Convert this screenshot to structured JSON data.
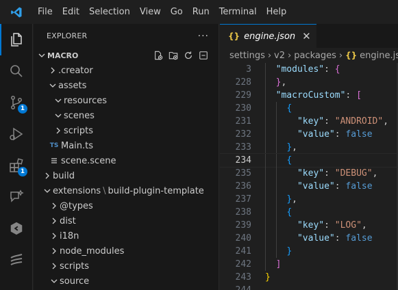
{
  "menu": [
    "File",
    "Edit",
    "Selection",
    "View",
    "Go",
    "Run",
    "Terminal",
    "Help"
  ],
  "activity": {
    "source_control_badge": "1",
    "extensions_badge": "1"
  },
  "explorer": {
    "title": "EXPLORER",
    "more": "···",
    "root": "MACRO",
    "tree": [
      {
        "label": ".creator",
        "chevron": "right"
      },
      {
        "label": "assets",
        "chevron": "down"
      },
      {
        "label": "resources",
        "chevron": "down"
      },
      {
        "label": "scenes",
        "chevron": "down"
      },
      {
        "label": "scripts",
        "chevron": "right"
      },
      {
        "label": "Main.ts",
        "type": "TS"
      },
      {
        "label": "scene.scene",
        "type": "scene"
      },
      {
        "label": "build",
        "chevron": "right"
      },
      {
        "label": "extensions",
        "label2": "build-plugin-template",
        "chevron": "down"
      },
      {
        "label": "@types",
        "chevron": "right"
      },
      {
        "label": "dist",
        "chevron": "right"
      },
      {
        "label": "i18n",
        "chevron": "right"
      },
      {
        "label": "node_modules",
        "chevron": "right"
      },
      {
        "label": "scripts",
        "chevron": "right"
      },
      {
        "label": "source",
        "chevron": "down"
      }
    ]
  },
  "editor": {
    "tab": {
      "icon": "{}",
      "label": "engine.json"
    },
    "breadcrumb": [
      "settings",
      "v2",
      "packages",
      "engine.json"
    ],
    "lines": [
      {
        "n": "3"
      },
      {
        "n": "228"
      },
      {
        "n": "229"
      },
      {
        "n": "230"
      },
      {
        "n": "231"
      },
      {
        "n": "232"
      },
      {
        "n": "233"
      },
      {
        "n": "234"
      },
      {
        "n": "235"
      },
      {
        "n": "236"
      },
      {
        "n": "237"
      },
      {
        "n": "238"
      },
      {
        "n": "239"
      },
      {
        "n": "240"
      },
      {
        "n": "241"
      },
      {
        "n": "242"
      },
      {
        "n": "243"
      },
      {
        "n": "244"
      }
    ],
    "tokens": {
      "modules_key": "\"modules\"",
      "macroCustom_key": "\"macroCustom\"",
      "key": "\"key\"",
      "value": "\"value\"",
      "android": "\"ANDROID\"",
      "debug": "\"DEBUG\"",
      "log": "\"LOG\"",
      "false": "false"
    }
  }
}
